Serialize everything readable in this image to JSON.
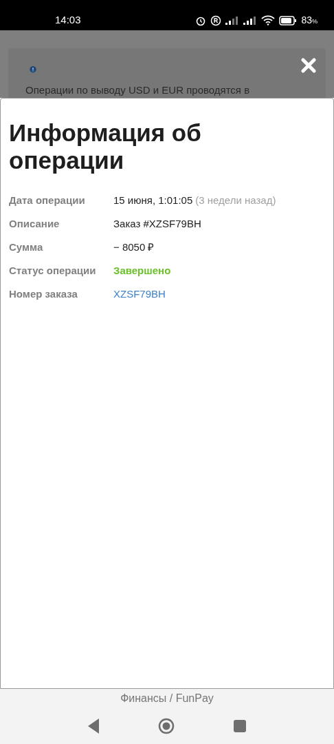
{
  "status_bar": {
    "time": "14:03",
    "battery": "83",
    "battery_unit": "%"
  },
  "background_notice": {
    "text": "Операции по выводу USD и EUR проводятся в"
  },
  "modal": {
    "title": "Информация об операции",
    "rows": [
      {
        "label": "Дата операции",
        "value": "15 июня, 1:01:05",
        "note": "(3 недели назад)",
        "kind": "text"
      },
      {
        "label": "Описание",
        "value": "Заказ #XZSF79BH",
        "kind": "text"
      },
      {
        "label": "Сумма",
        "value": "− 8050 ₽",
        "kind": "text"
      },
      {
        "label": "Статус операции",
        "value": "Завершено",
        "kind": "status"
      },
      {
        "label": "Номер заказа",
        "value": "XZSF79BH",
        "kind": "link"
      }
    ]
  },
  "footer": {
    "caption": "Финансы / FunPay"
  }
}
